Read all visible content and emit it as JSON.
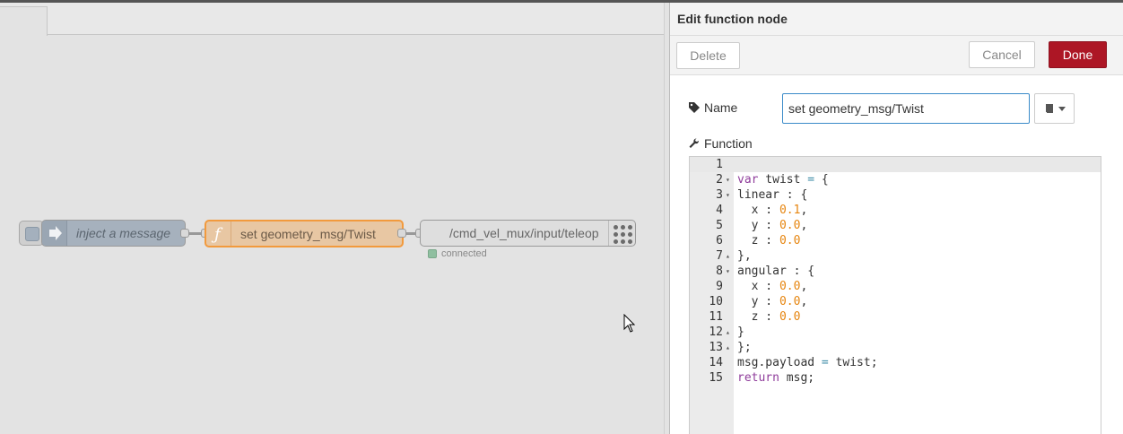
{
  "workspace": {
    "nodes": {
      "inject": {
        "label": "inject a message"
      },
      "function": {
        "label": "set geometry_msg/Twist"
      },
      "ros": {
        "label": "/cmd_vel_mux/input/teleop",
        "status": "connected"
      }
    }
  },
  "tray": {
    "title": "Edit function node",
    "buttons": {
      "delete": "Delete",
      "cancel": "Cancel",
      "done": "Done"
    },
    "name_label": "Name",
    "name_value": "set geometry_msg/Twist",
    "function_label": "Function",
    "code_lines": [
      {
        "n": "1",
        "fold": "",
        "html": ""
      },
      {
        "n": "2",
        "fold": "▾",
        "html": "<span class='kw'>var</span> twist <span class='op'>=</span> {"
      },
      {
        "n": "3",
        "fold": "▾",
        "html": "linear : {"
      },
      {
        "n": "4",
        "fold": "",
        "html": "  x : <span class='num'>0.1</span>,"
      },
      {
        "n": "5",
        "fold": "",
        "html": "  y : <span class='num'>0.0</span>,"
      },
      {
        "n": "6",
        "fold": "",
        "html": "  z : <span class='num'>0.0</span>"
      },
      {
        "n": "7",
        "fold": "▴",
        "html": "},"
      },
      {
        "n": "8",
        "fold": "▾",
        "html": "angular : {"
      },
      {
        "n": "9",
        "fold": "",
        "html": "  x : <span class='num'>0.0</span>,"
      },
      {
        "n": "10",
        "fold": "",
        "html": "  y : <span class='num'>0.0</span>,"
      },
      {
        "n": "11",
        "fold": "",
        "html": "  z : <span class='num'>0.0</span>"
      },
      {
        "n": "12",
        "fold": "▴",
        "html": "}"
      },
      {
        "n": "13",
        "fold": "▴",
        "html": "};"
      },
      {
        "n": "14",
        "fold": "",
        "html": "msg.payload <span class='op'>=</span> twist;"
      },
      {
        "n": "15",
        "fold": "",
        "html": "<span class='kw'>return</span> msg;"
      }
    ]
  },
  "colors": {
    "done": "#ad1625",
    "function_node": "#e8c7a3",
    "inject_node": "#a6b1bd"
  },
  "icons": [
    "arrow-right-icon",
    "function-icon",
    "grid-dots-icon",
    "tag-icon",
    "wrench-icon",
    "book-icon",
    "caret-down-icon",
    "mouse-cursor-icon"
  ]
}
